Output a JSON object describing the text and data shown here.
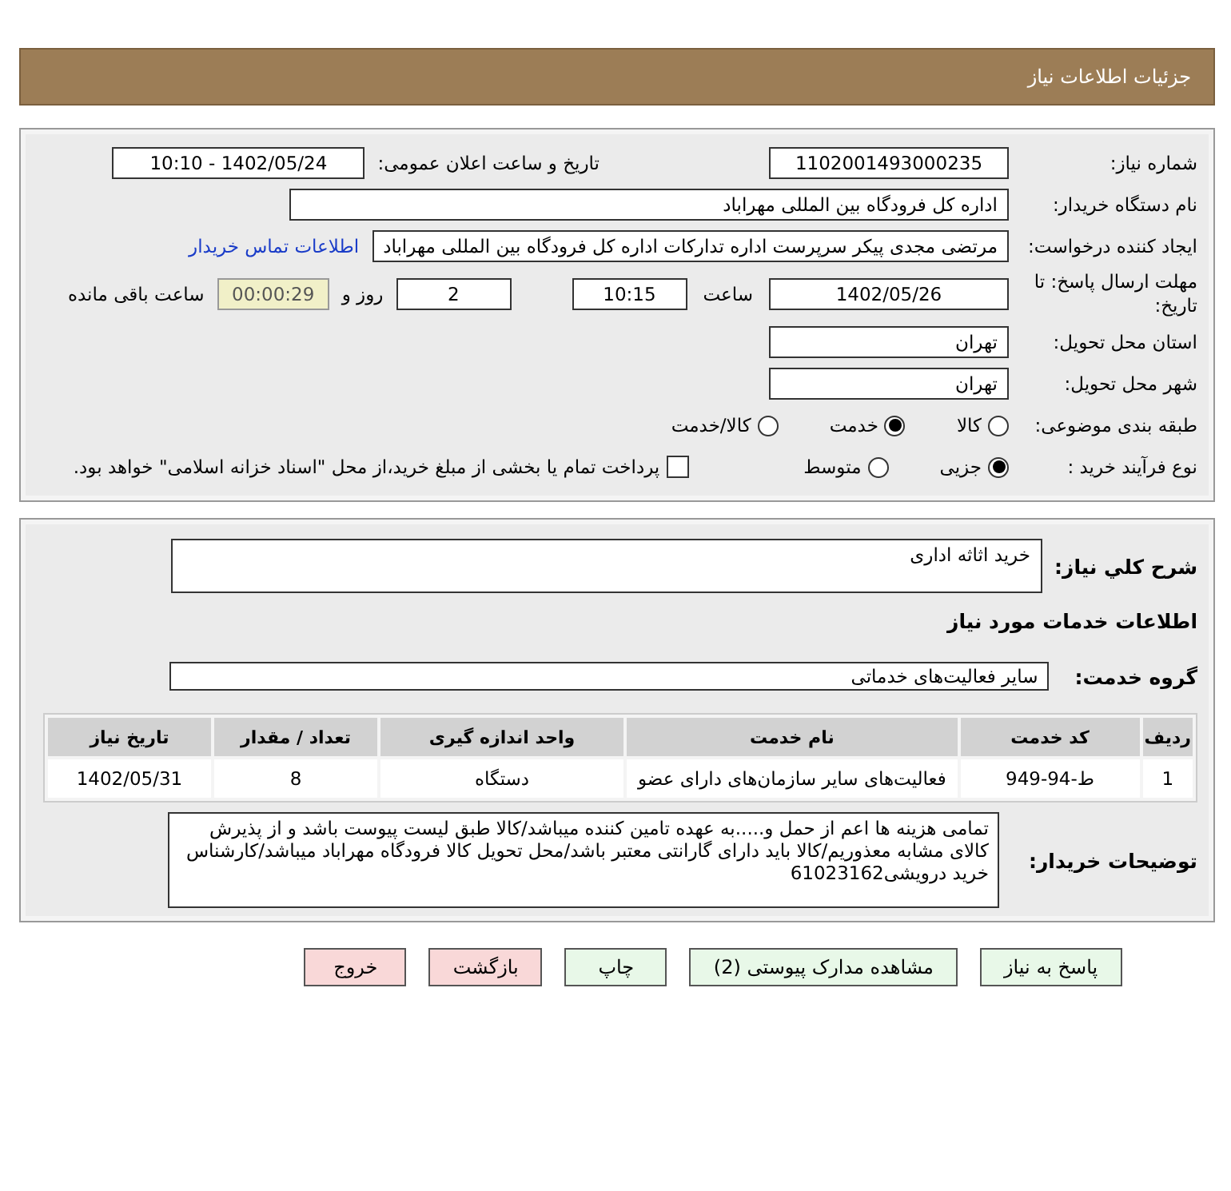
{
  "header": {
    "title": "جزئیات اطلاعات نیاز"
  },
  "details": {
    "need_number": {
      "label": "شماره نیاز:",
      "value": "1102001493000235"
    },
    "announce": {
      "label": "تاریخ و ساعت اعلان عمومی:",
      "value": "1402/05/24 - 10:10"
    },
    "buyer": {
      "label": "نام دستگاه خریدار:",
      "value": "اداره کل فرودگاه بین المللی مهراباد"
    },
    "requester": {
      "label": "ایجاد کننده درخواست:",
      "value": "مرتضی مجدی پیکر سرپرست اداره تدارکات  اداره کل فرودگاه بین المللی مهراباد",
      "link": "اطلاعات تماس خریدار"
    },
    "deadline": {
      "label": "مهلت ارسال پاسخ: تا تاریخ:",
      "date": "1402/05/26",
      "time_label": "ساعت",
      "time": "10:15",
      "days": "2",
      "days_label": "روز و",
      "remaining": "00:00:29",
      "remaining_label": "ساعت باقی مانده"
    },
    "province": {
      "label": "استان محل تحویل:",
      "value": "تهران"
    },
    "city": {
      "label": "شهر محل تحویل:",
      "value": "تهران"
    },
    "category": {
      "label": "طبقه بندی موضوعی:",
      "options": [
        {
          "label": "کالا",
          "selected": false
        },
        {
          "label": "خدمت",
          "selected": true
        },
        {
          "label": "کالا/خدمت",
          "selected": false
        }
      ]
    },
    "process": {
      "label": "نوع فرآیند خرید :",
      "options": [
        {
          "label": "جزیی",
          "selected": true
        },
        {
          "label": "متوسط",
          "selected": false
        }
      ],
      "payment": {
        "checked": false,
        "text": "پرداخت تمام یا بخشی از مبلغ خرید،از محل \"اسناد خزانه اسلامی\" خواهد بود."
      }
    }
  },
  "summary": {
    "description": {
      "label": "شرح کلي نياز:",
      "value": "خرید اثاثه اداری"
    },
    "section_title": "اطلاعات خدمات مورد نیاز",
    "service_group": {
      "label": "گروه خدمت:",
      "value": "سایر فعالیت‌های خدماتی"
    },
    "table": {
      "columns": [
        "ردیف",
        "کد خدمت",
        "نام خدمت",
        "واحد اندازه گیری",
        "تعداد / مقدار",
        "تاریخ نیاز"
      ],
      "rows": [
        [
          "1",
          "ط-94-949",
          "فعالیت‌های سایر سازمان‌های دارای عضو",
          "دستگاه",
          "8",
          "1402/05/31"
        ]
      ]
    },
    "buyer_notes": {
      "label": "توضیحات خریدار:",
      "value": "تمامی هزینه ها اعم از حمل و.....به عهده تامین کننده میباشد/کالا طبق لیست پیوست باشد و از پذیرش کالای مشابه معذوریم/کالا باید دارای گارانتی معتبر باشد/محل تحویل کالا فرودگاه مهراباد میباشد/کارشناس خرید درویشی61023162"
    }
  },
  "buttons": [
    {
      "label": "پاسخ به نیاز",
      "kind": "normal"
    },
    {
      "label": "مشاهده مدارک پیوستی (2)",
      "kind": "normal"
    },
    {
      "label": "چاپ",
      "kind": "normal"
    },
    {
      "label": "بازگشت",
      "kind": "danger"
    },
    {
      "label": "خروج",
      "kind": "danger"
    }
  ]
}
